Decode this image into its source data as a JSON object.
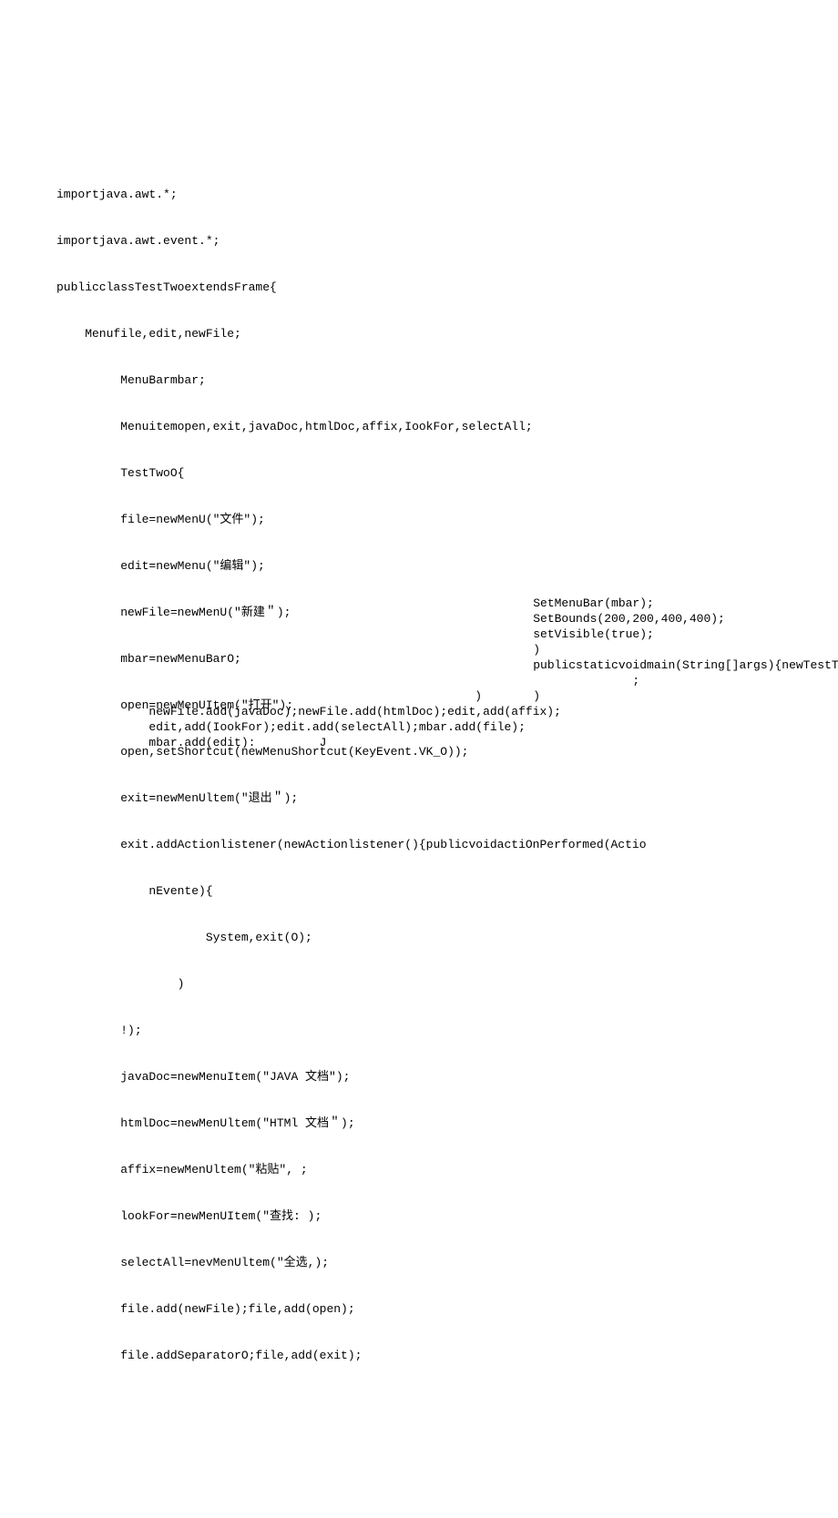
{
  "lines": [
    "importjava.awt.*;",
    "importjava.awt.event.*;",
    "publicclassTestTwoextendsFrame{",
    "    Menufile,edit,newFile;",
    "         MenuBarmbar;",
    "         Menuitemopen,exit,javaDoc,htmlDoc,affix,IookFor,selectAll;",
    "         TestTwoO{",
    "         file=newMenU(\"文件\");",
    "         edit=newMenu(\"编辑\");",
    "         newFile=newMenU(\"新建＂);",
    "         mbar=newMenuBarO;",
    "         open=newMenUItem(\"打开\");",
    "         open,setShortcut(newMenuShortcut(KeyEvent.VK_O));",
    "         exit=newMenUltem(\"退出＂);",
    "         exit.addActionlistener(newActionlistener(){publicvoidactiOnPerformed(Actio",
    "             nEvente){",
    "                     System,exit(O);",
    "                 )",
    "         !);",
    "         javaDoc=newMenuItem(\"JAVA 文档\");",
    "         htmlDoc=newMenUltem(\"HTMl 文档＂);",
    "         affix=newMenUltem(\"粘贴\", ;",
    "         lookFor=newMenUItem(\"查找: );",
    "         selectAll=nevMenUltem(\"全选,);",
    "         file.add(newFile);file,add(open);",
    "         file.addSeparatorO;file,add(exit);"
  ],
  "side_lines": [
    "SetMenuBar(mbar);",
    "SetBounds(200,200,400,400);",
    "setVisible(true);",
    ")",
    "publicstaticvoidmain(String[]args){newTestTwoO",
    "              ;",
    ")"
  ],
  "close_paren": ")",
  "tail_lines": [
    "         newFile.add(javaDoc);newFile.add(htmlDoc);edit,add(affix);",
    "         edit,add(IookFor);edit.add(selectAll);mbar.add(file);",
    "         mbar.add(edit):         J"
  ]
}
